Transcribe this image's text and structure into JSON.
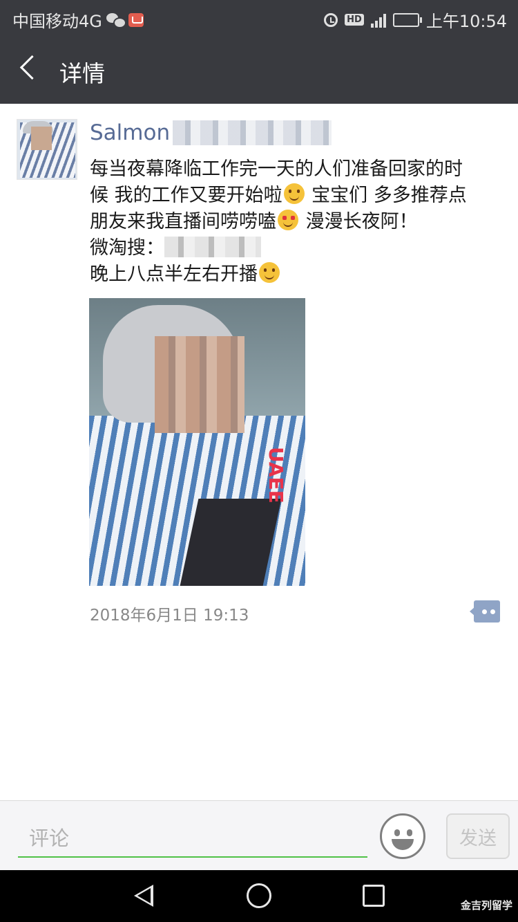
{
  "status_bar": {
    "carrier": "中国移动4G",
    "network_badge": "4G",
    "hd_label": "HD",
    "time": "上午10:54",
    "battery_level": 1.0,
    "icons": [
      "wechat-icon",
      "mail-icon",
      "alarm-icon",
      "signal-icon",
      "battery-icon"
    ]
  },
  "header": {
    "title": "详情",
    "back_icon": "chevron-left-icon"
  },
  "post": {
    "author": "Salmon",
    "text_lines": [
      "每当夜幕降临工作完一天的人们准备回家的时",
      "候 我的工作又要开始啦",
      " 宝宝们 多多推荐点",
      "朋友来我直播间唠唠嗑",
      " 漫漫长夜阿！",
      "微淘搜：",
      "晚上八点半左右开播"
    ],
    "timestamp": "2018年6月1日 19:13",
    "photo_label": "UAEE",
    "action_icon": "comment-more-icon"
  },
  "comment_bar": {
    "placeholder": "评论",
    "emoji_icon": "emoji-icon",
    "send_label": "发送"
  },
  "system_nav": {
    "icons": [
      "nav-back-icon",
      "nav-home-icon",
      "nav-recent-icon"
    ],
    "watermark": "金吉列留学"
  },
  "colors": {
    "header_bg": "#393a3f",
    "author_name": "#576b95",
    "input_underline": "#4fc147",
    "action_button": "#8fa4c6"
  }
}
